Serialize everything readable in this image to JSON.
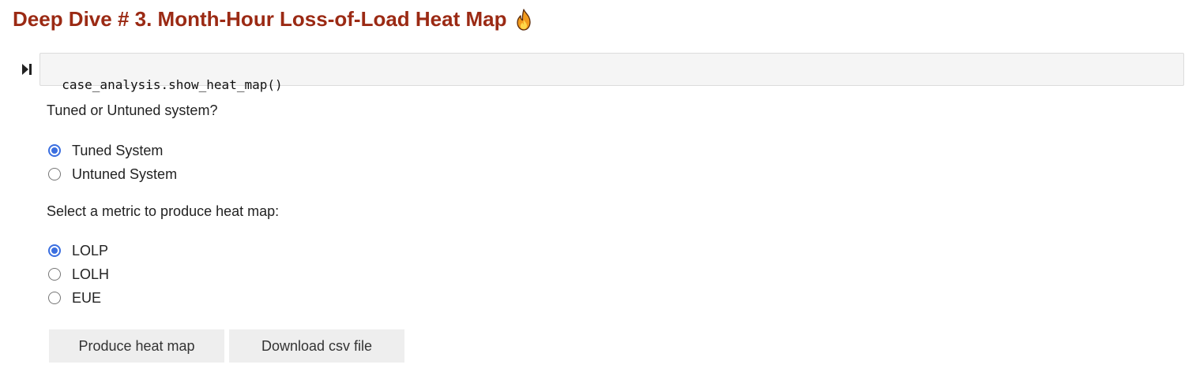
{
  "heading": {
    "title": "Deep Dive # 3. Month-Hour Loss-of-Load Heat Map",
    "emoji_icon": "flame-icon"
  },
  "code_cell": {
    "run_icon": "run-cell-icon",
    "code": "case_analysis.show_heat_map()"
  },
  "system_question": {
    "label": "Tuned or Untuned system?",
    "options": [
      {
        "label": "Tuned System",
        "checked": true
      },
      {
        "label": "Untuned System",
        "checked": false
      }
    ]
  },
  "metric_question": {
    "label": "Select a metric to produce heat map:",
    "options": [
      {
        "label": "LOLP",
        "checked": true
      },
      {
        "label": "LOLH",
        "checked": false
      },
      {
        "label": "EUE",
        "checked": false
      }
    ]
  },
  "buttons": {
    "produce": "Produce heat map",
    "download": "Download csv file"
  },
  "colors": {
    "heading": "#9b2a14",
    "radio_accent": "#3b6fe0",
    "button_bg": "#eeeeee",
    "code_bg": "#f5f5f5"
  }
}
